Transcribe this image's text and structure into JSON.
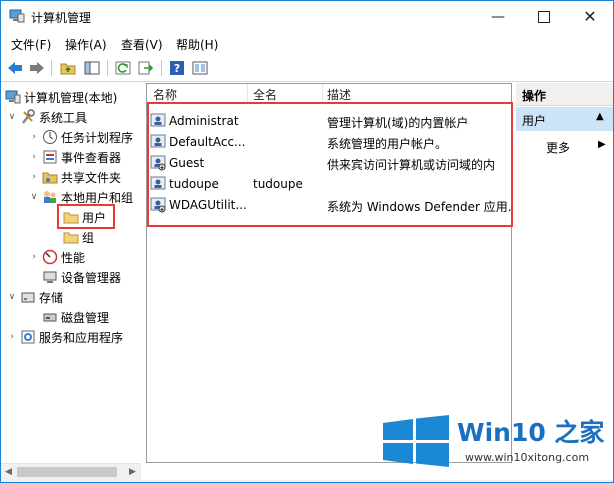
{
  "window": {
    "title": "计算机管理"
  },
  "menu": [
    "文件(F)",
    "操作(A)",
    "查看(V)",
    "帮助(H)"
  ],
  "toolbar_icons": [
    "back-icon",
    "forward-icon",
    "up-folder-icon",
    "show-hide-tree-icon",
    "refresh-icon",
    "export-icon",
    "help-icon",
    "properties-icon"
  ],
  "tree": {
    "root": "计算机管理(本地)",
    "system_tools": "系统工具",
    "task_scheduler": "任务计划程序",
    "event_viewer": "事件查看器",
    "shared_folders": "共享文件夹",
    "local_users": "本地用户和组",
    "users": "用户",
    "groups": "组",
    "performance": "性能",
    "device_manager": "设备管理器",
    "storage": "存储",
    "disk_management": "磁盘管理",
    "services": "服务和应用程序"
  },
  "list": {
    "columns": [
      "名称",
      "全名",
      "描述"
    ],
    "rows": [
      {
        "name": "Administrat",
        "fullname": "",
        "description": "管理计算机(域)的内置帐户"
      },
      {
        "name": "DefaultAcc...",
        "fullname": "",
        "description": "系统管理的用户帐户。"
      },
      {
        "name": "Guest",
        "fullname": "",
        "description": "供来宾访问计算机或访问域的内"
      },
      {
        "name": "tudoupe",
        "fullname": "tudoupe",
        "description": ""
      },
      {
        "name": "WDAGUtilit...",
        "fullname": "",
        "description": "系统为 Windows Defender 应用."
      }
    ]
  },
  "actions": {
    "header": "操作",
    "section": "用户",
    "more": "更多"
  },
  "watermark": {
    "brand": "Win10 之家",
    "url": "www.win10xitong.com"
  },
  "colors": {
    "highlight": "#e83a3a",
    "selection": "#cce4f7",
    "brand": "#1b6fbf"
  }
}
